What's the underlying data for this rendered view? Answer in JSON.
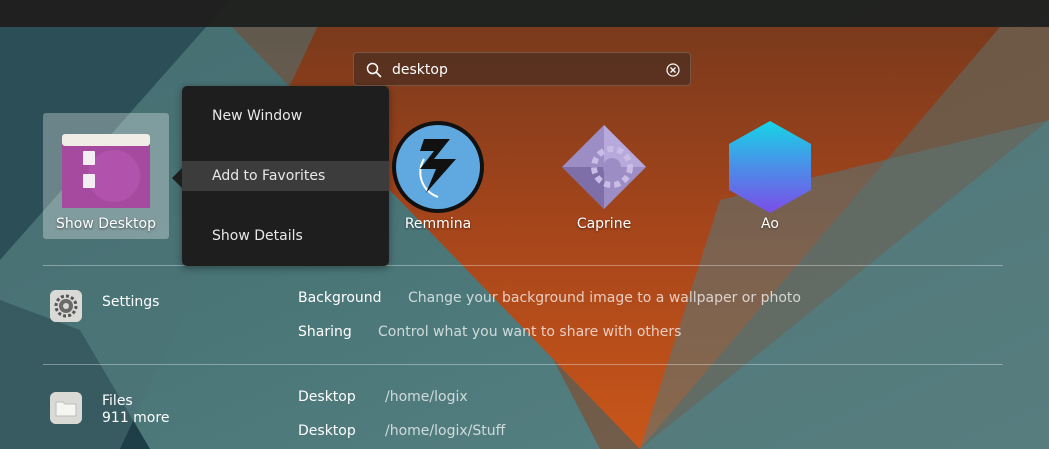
{
  "search": {
    "value": "desktop"
  },
  "apps": [
    {
      "name": "Show Desktop",
      "icon": "show-desktop-icon"
    },
    {
      "name": "Remmina",
      "icon": "remmina-icon"
    },
    {
      "name": "Caprine",
      "icon": "caprine-icon"
    },
    {
      "name": "Ao",
      "icon": "ao-icon"
    }
  ],
  "context_menu": {
    "items": [
      {
        "label": "New Window"
      },
      {
        "label": "Add to Favorites"
      },
      {
        "label": "Show Details"
      }
    ]
  },
  "providers": [
    {
      "name": "Settings",
      "icon": "settings-gear-icon",
      "results": [
        {
          "title": "Background",
          "description": "Change your background image to a wallpaper or photo"
        },
        {
          "title": "Sharing",
          "description": "Control what you want to share with others"
        }
      ]
    },
    {
      "name": "Files",
      "subtitle": "911 more",
      "icon": "folder-icon",
      "results": [
        {
          "title": "Desktop",
          "description": "/home/logix"
        },
        {
          "title": "Desktop",
          "description": "/home/logix/Stuff"
        }
      ]
    }
  ],
  "colors": {
    "accent_orange": "#c2531a",
    "teal": "#3e6d70",
    "menu_bg": "#1e1e1e"
  }
}
